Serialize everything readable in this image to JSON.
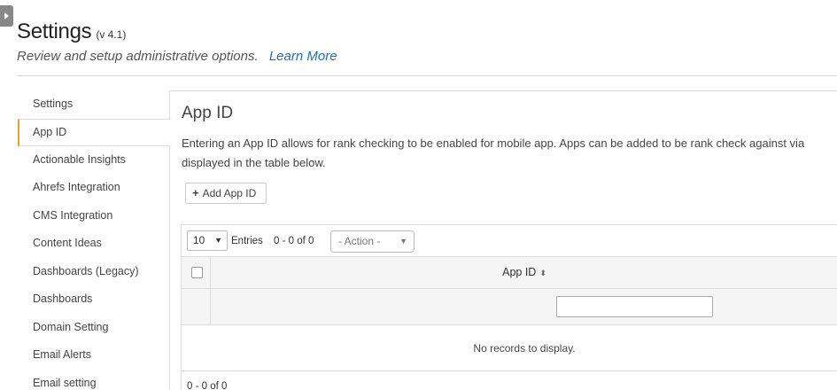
{
  "header": {
    "title": "Settings",
    "version": "(v 4.1)",
    "subtitle": "Review and setup administrative options.",
    "learn_more": "Learn More"
  },
  "sidebar": {
    "items": [
      {
        "label": "Settings"
      },
      {
        "label": "App ID"
      },
      {
        "label": "Actionable Insights"
      },
      {
        "label": "Ahrefs Integration"
      },
      {
        "label": "CMS Integration"
      },
      {
        "label": "Content Ideas"
      },
      {
        "label": "Dashboards (Legacy)"
      },
      {
        "label": "Dashboards"
      },
      {
        "label": "Domain Setting"
      },
      {
        "label": "Email Alerts"
      },
      {
        "label": "Email setting"
      }
    ],
    "active_index": 1
  },
  "main": {
    "title": "App ID",
    "description_line1": "Entering an App ID allows for rank checking to be enabled for mobile app. Apps can be added to be rank check against via",
    "description_line2": "displayed in the table below.",
    "add_button": "Add App ID"
  },
  "grid": {
    "page_size": "10",
    "entries_label": "Entries",
    "range_top": "0 - 0 of 0",
    "action_placeholder": "- Action -",
    "columns": [
      "App ID"
    ],
    "filter_value": "",
    "empty_message": "No records to display.",
    "range_bottom": "0 - 0 of 0"
  },
  "icons": {
    "toggle": "chevron-right-icon",
    "add": "plus-icon",
    "sort": "sort-icon",
    "dropdown": "caret-down-icon"
  },
  "colors": {
    "accent": "#f0a030",
    "link": "#1e6fb8"
  }
}
